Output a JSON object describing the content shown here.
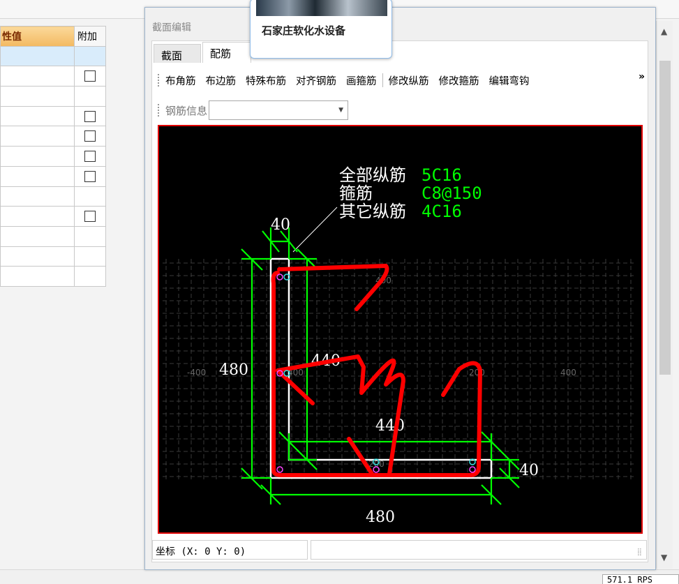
{
  "left_table": {
    "header_value": "性值",
    "header_add": "附加",
    "rows": [
      {
        "checkbox": false,
        "selected": true
      },
      {
        "checkbox": true
      },
      {
        "checkbox": false
      },
      {
        "checkbox": true
      },
      {
        "checkbox": true
      },
      {
        "checkbox": true
      },
      {
        "checkbox": true
      },
      {
        "checkbox": false
      },
      {
        "checkbox": true
      },
      {
        "checkbox": false
      },
      {
        "checkbox": false
      },
      {
        "checkbox": false
      }
    ]
  },
  "popup": {
    "title": "石家庄软化水设备"
  },
  "dialog": {
    "title": "截面编辑",
    "tabs": [
      {
        "label": "截面",
        "active": false
      },
      {
        "label": "配筋",
        "active": true
      }
    ],
    "toolbar": {
      "buttons": [
        "布角筋",
        "布边筋",
        "特殊布筋",
        "对齐钢筋",
        "画箍筋"
      ],
      "buttons2": [
        "修改纵筋",
        "修改箍筋",
        "编辑弯钩"
      ],
      "more": "»"
    },
    "info": {
      "label": "钢筋信息",
      "value": ""
    },
    "drawing": {
      "legend": [
        {
          "label": "全部纵筋",
          "value": "5C16"
        },
        {
          "label": "箍筋",
          "value": "C8@150"
        },
        {
          "label": "其它纵筋",
          "value": "4C16"
        }
      ],
      "dims": {
        "top_width": "40",
        "left_height": "480",
        "inner_height": "440",
        "inner_width": "440",
        "right_thick": "40",
        "bottom_width": "480"
      },
      "grid_labels": [
        "400",
        "400",
        "200",
        "400",
        "-400",
        "200"
      ]
    },
    "coord": "坐标 (X: 0 Y: 0)"
  },
  "status": {
    "right_box": "571.1 RPS"
  },
  "colors": {
    "canvas_bg": "#000000",
    "outline": "#ffffff",
    "dimension": "#00ff00",
    "rebar": "#ff0000",
    "canvas_border": "#e00000"
  }
}
